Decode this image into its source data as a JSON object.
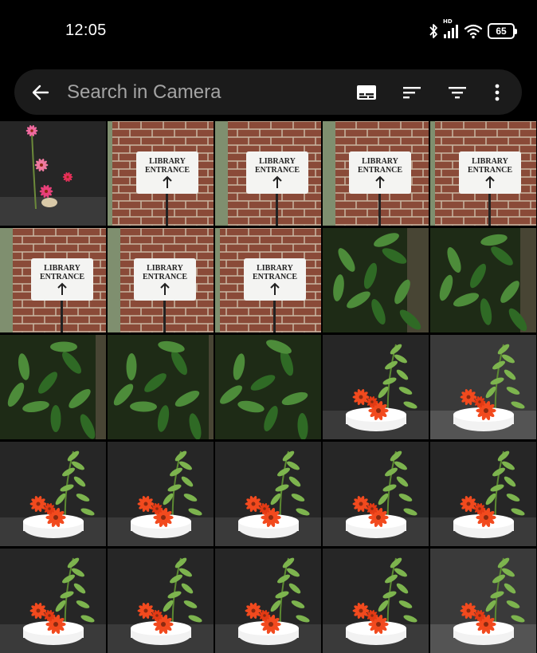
{
  "status_bar": {
    "time": "12:05",
    "battery_level": "65",
    "network_badge": "HD",
    "icons": [
      "bluetooth-icon",
      "signal-icon",
      "wifi-icon",
      "battery-icon"
    ]
  },
  "search": {
    "placeholder": "Search in Camera",
    "value": "",
    "actions": [
      "back-arrow-icon",
      "subtitles-icon",
      "sort-icon",
      "filter-icon",
      "more-vert-icon"
    ]
  },
  "gallery": {
    "photos": [
      {
        "kind": "ikebana-pink"
      },
      {
        "kind": "library-sign",
        "line1": "LIBRARY",
        "line2": "ENTRANCE"
      },
      {
        "kind": "library-sign",
        "line1": "LIBRARY",
        "line2": "ENTRANCE"
      },
      {
        "kind": "library-sign",
        "line1": "LIBRARY",
        "line2": "ENTRANCE"
      },
      {
        "kind": "library-sign",
        "line1": "LIBRARY",
        "line2": "ENTRANCE"
      },
      {
        "kind": "library-sign",
        "line1": "LIBRARY",
        "line2": "ENTRANCE"
      },
      {
        "kind": "library-sign",
        "line1": "LIBRARY",
        "line2": "ENTRANCE"
      },
      {
        "kind": "library-sign",
        "line1": "LIBRARY",
        "line2": "ENTRANCE"
      },
      {
        "kind": "leaves"
      },
      {
        "kind": "leaves"
      },
      {
        "kind": "leaves"
      },
      {
        "kind": "leaves"
      },
      {
        "kind": "leaves"
      },
      {
        "kind": "ikebana-orange"
      },
      {
        "kind": "ikebana-orange-light"
      },
      {
        "kind": "ikebana-orange"
      },
      {
        "kind": "ikebana-orange"
      },
      {
        "kind": "ikebana-orange"
      },
      {
        "kind": "ikebana-orange"
      },
      {
        "kind": "ikebana-orange"
      },
      {
        "kind": "ikebana-orange"
      },
      {
        "kind": "ikebana-orange"
      },
      {
        "kind": "ikebana-orange"
      },
      {
        "kind": "ikebana-orange"
      },
      {
        "kind": "ikebana-orange-light"
      }
    ]
  },
  "colors": {
    "background": "#000000",
    "search_bar": "#1b1b1b",
    "placeholder": "#a4a4a4",
    "brick": "#8a4a38",
    "foliage": "#2f6a25",
    "flower_orange": "#f24a1e",
    "flower_pink": "#e8407a"
  }
}
